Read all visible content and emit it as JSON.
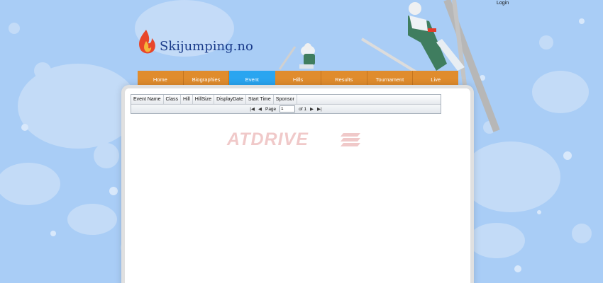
{
  "header": {
    "login_label": "Login",
    "logo_text": "Skijumping.no"
  },
  "nav": {
    "items": [
      {
        "label": "Home",
        "active": false
      },
      {
        "label": "Biographies",
        "active": false
      },
      {
        "label": "Event",
        "active": true
      },
      {
        "label": "Hills",
        "active": false
      },
      {
        "label": "Results",
        "active": false
      },
      {
        "label": "Tournament",
        "active": false
      },
      {
        "label": "Live",
        "active": false
      }
    ]
  },
  "grid": {
    "columns": [
      "Event Name",
      "Class",
      "Hill",
      "HillSize",
      "DisplayDate",
      "Start Time",
      "Sponsor"
    ],
    "pager": {
      "page_label": "Page",
      "page_value": "1",
      "of_label": "of 1"
    }
  },
  "watermark": {
    "text": "ATDRIVE"
  },
  "colors": {
    "background": "#a9cdf6",
    "nav": "#e08c2d",
    "nav_active": "#2aa5f0",
    "logo_text": "#1a3b8a"
  }
}
